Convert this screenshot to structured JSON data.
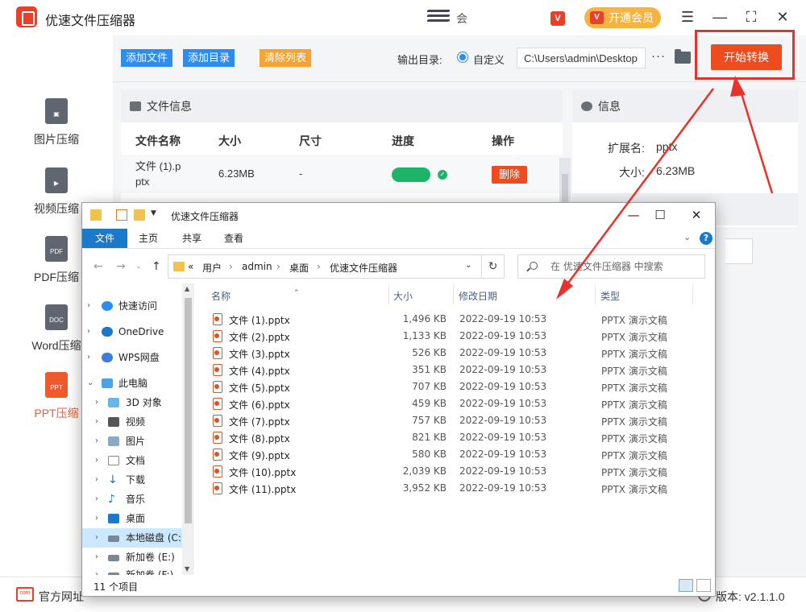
{
  "app": {
    "title": "优速文件压缩器",
    "ad_text": "会",
    "vip_label": "开通会员",
    "window_controls": [
      "menu-icon",
      "minimize-icon",
      "maximize-icon",
      "close-icon"
    ]
  },
  "sidebar": {
    "items": [
      {
        "label": "图片压缩",
        "icon": "image-file-icon",
        "active": false
      },
      {
        "label": "视频压缩",
        "icon": "video-file-icon",
        "active": false
      },
      {
        "label": "PDF压缩",
        "icon": "pdf-file-icon",
        "icon_text": "PDF",
        "active": false
      },
      {
        "label": "Word压缩",
        "icon": "doc-file-icon",
        "icon_text": "DOC",
        "active": false
      },
      {
        "label": "PPT压缩",
        "icon": "ppt-file-icon",
        "icon_text": "PPT",
        "active": true
      }
    ]
  },
  "toolbar": {
    "add_file": "添加文件",
    "add_dir": "添加目录",
    "clear_list": "清除列表",
    "output_label": "输出目录:",
    "radio_label": "自定义",
    "output_path": "C:\\Users\\admin\\Desktop",
    "more": "···",
    "start": "开始转换",
    "colors": {
      "blue": "#2d8cf0",
      "orange": "#f7a330",
      "start": "#ee4b1e"
    }
  },
  "file_info": {
    "header": "文件信息",
    "columns": [
      "文件名称",
      "大小",
      "尺寸",
      "进度",
      "操作"
    ],
    "rows": [
      {
        "name": "文件 (1).pptx",
        "name_line1": "文件 (1).p",
        "name_line2": "ptx",
        "size": "6.23MB",
        "dim": "-",
        "progress": 1.0,
        "action": "删除"
      }
    ]
  },
  "info": {
    "header": "信息",
    "ext_label": "扩展名:",
    "ext_value": "pptx",
    "size_label": "大小:",
    "size_value": "6.23MB"
  },
  "bottom": {
    "site": "官方网址",
    "version": "版本: v2.1.1.0"
  },
  "explorer": {
    "title": "优速文件压缩器",
    "tabs": [
      "文件",
      "主页",
      "共享",
      "查看"
    ],
    "breadcrumb": [
      "«",
      "用户",
      "admin",
      "桌面",
      "优速文件压缩器"
    ],
    "search_placeholder": "在 优速文件压缩器 中搜索",
    "nav": [
      {
        "label": "快速访问",
        "icon": "star-icon"
      },
      {
        "label": "OneDrive",
        "icon": "cloud-icon"
      },
      {
        "label": "WPS网盘",
        "icon": "cloud-icon"
      },
      {
        "label": "此电脑",
        "icon": "computer-icon"
      },
      {
        "label": "3D 对象",
        "icon": "cube-icon"
      },
      {
        "label": "视频",
        "icon": "video-icon"
      },
      {
        "label": "图片",
        "icon": "picture-icon"
      },
      {
        "label": "文档",
        "icon": "document-icon"
      },
      {
        "label": "下载",
        "icon": "download-icon"
      },
      {
        "label": "音乐",
        "icon": "music-icon"
      },
      {
        "label": "桌面",
        "icon": "desktop-icon"
      },
      {
        "label": "本地磁盘 (C:)",
        "icon": "drive-icon"
      },
      {
        "label": "新加卷 (E:)",
        "icon": "drive-icon"
      },
      {
        "label": "新加卷 (F:)",
        "icon": "drive-icon"
      }
    ],
    "columns": [
      "名称",
      "大小",
      "修改日期",
      "类型"
    ],
    "files": [
      {
        "name": "文件 (1).pptx",
        "size": "1,496 KB",
        "date": "2022-09-19 10:53",
        "type": "PPTX 演示文稿"
      },
      {
        "name": "文件 (2).pptx",
        "size": "1,133 KB",
        "date": "2022-09-19 10:53",
        "type": "PPTX 演示文稿"
      },
      {
        "name": "文件 (3).pptx",
        "size": "526 KB",
        "date": "2022-09-19 10:53",
        "type": "PPTX 演示文稿"
      },
      {
        "name": "文件 (4).pptx",
        "size": "351 KB",
        "date": "2022-09-19 10:53",
        "type": "PPTX 演示文稿"
      },
      {
        "name": "文件 (5).pptx",
        "size": "707 KB",
        "date": "2022-09-19 10:53",
        "type": "PPTX 演示文稿"
      },
      {
        "name": "文件 (6).pptx",
        "size": "459 KB",
        "date": "2022-09-19 10:53",
        "type": "PPTX 演示文稿"
      },
      {
        "name": "文件 (7).pptx",
        "size": "757 KB",
        "date": "2022-09-19 10:53",
        "type": "PPTX 演示文稿"
      },
      {
        "name": "文件 (8).pptx",
        "size": "821 KB",
        "date": "2022-09-19 10:53",
        "type": "PPTX 演示文稿"
      },
      {
        "name": "文件 (9).pptx",
        "size": "580 KB",
        "date": "2022-09-19 10:53",
        "type": "PPTX 演示文稿"
      },
      {
        "name": "文件 (10).pptx",
        "size": "2,039 KB",
        "date": "2022-09-19 10:53",
        "type": "PPTX 演示文稿"
      },
      {
        "name": "文件 (11).pptx",
        "size": "3,952 KB",
        "date": "2022-09-19 10:53",
        "type": "PPTX 演示文稿"
      }
    ],
    "status": "11 个项目"
  }
}
